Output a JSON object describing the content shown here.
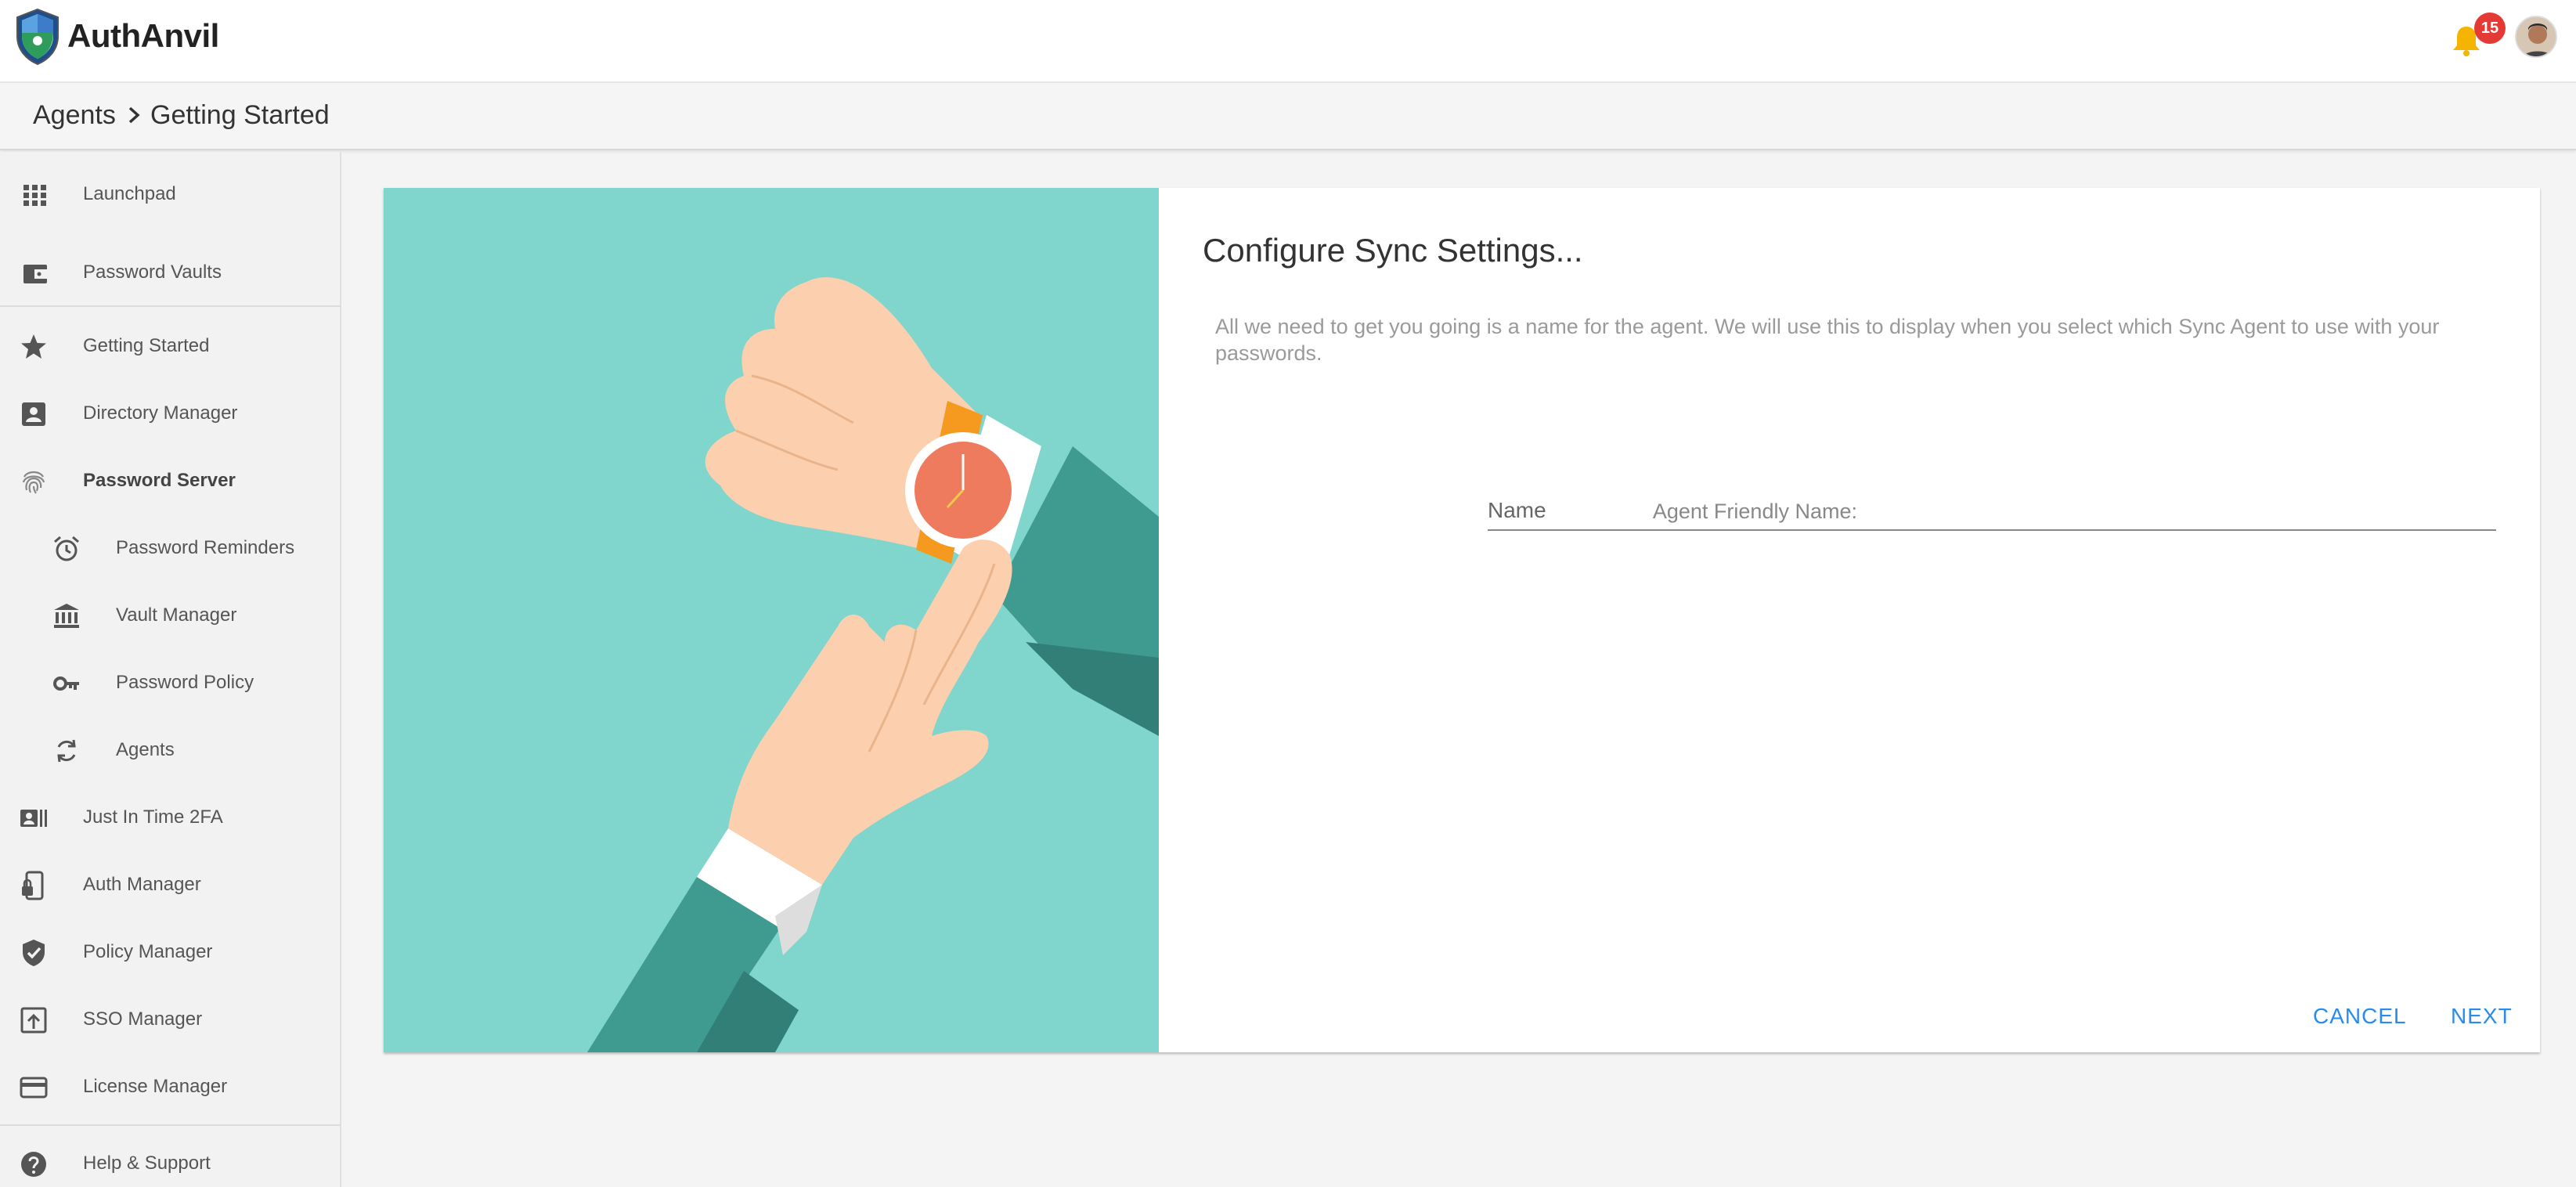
{
  "app": {
    "brand": "AuthAnvil",
    "notification_count": "15"
  },
  "breadcrumb": {
    "items": [
      "Agents",
      "Getting Started"
    ]
  },
  "sidebar": {
    "items": [
      {
        "label": "Launchpad",
        "icon": "grid-icon"
      },
      {
        "label": "Password Vaults",
        "icon": "wallet-icon"
      },
      {
        "label": "Getting Started",
        "icon": "star-icon"
      },
      {
        "label": "Directory Manager",
        "icon": "contact-icon"
      },
      {
        "label": "Password Server",
        "icon": "fingerprint-icon"
      },
      {
        "label": "Password Reminders",
        "icon": "alarm-icon"
      },
      {
        "label": "Vault Manager",
        "icon": "bank-icon"
      },
      {
        "label": "Password Policy",
        "icon": "key-icon"
      },
      {
        "label": "Agents",
        "icon": "sync-icon"
      },
      {
        "label": "Just In Time 2FA",
        "icon": "badge-icon"
      },
      {
        "label": "Auth Manager",
        "icon": "phone-lock-icon"
      },
      {
        "label": "Policy Manager",
        "icon": "shield-check-icon"
      },
      {
        "label": "SSO Manager",
        "icon": "upload-box-icon"
      },
      {
        "label": "License Manager",
        "icon": "credit-card-icon"
      },
      {
        "label": "Help & Support",
        "icon": "help-icon"
      }
    ]
  },
  "main": {
    "title": "Configure Sync Settings...",
    "description": "All we need to get you going is a name for the agent. We will use this to display when you select which Sync Agent to use with your passwords.",
    "field": {
      "label": "Agent Friendly Name:",
      "placeholder": "Name",
      "value": ""
    },
    "cancel_label": "CANCEL",
    "next_label": "NEXT"
  },
  "colors": {
    "accent": "#2a8be8",
    "illustration_bg": "#80d5cc",
    "badge": "#e53935",
    "bell": "#f5b400"
  }
}
